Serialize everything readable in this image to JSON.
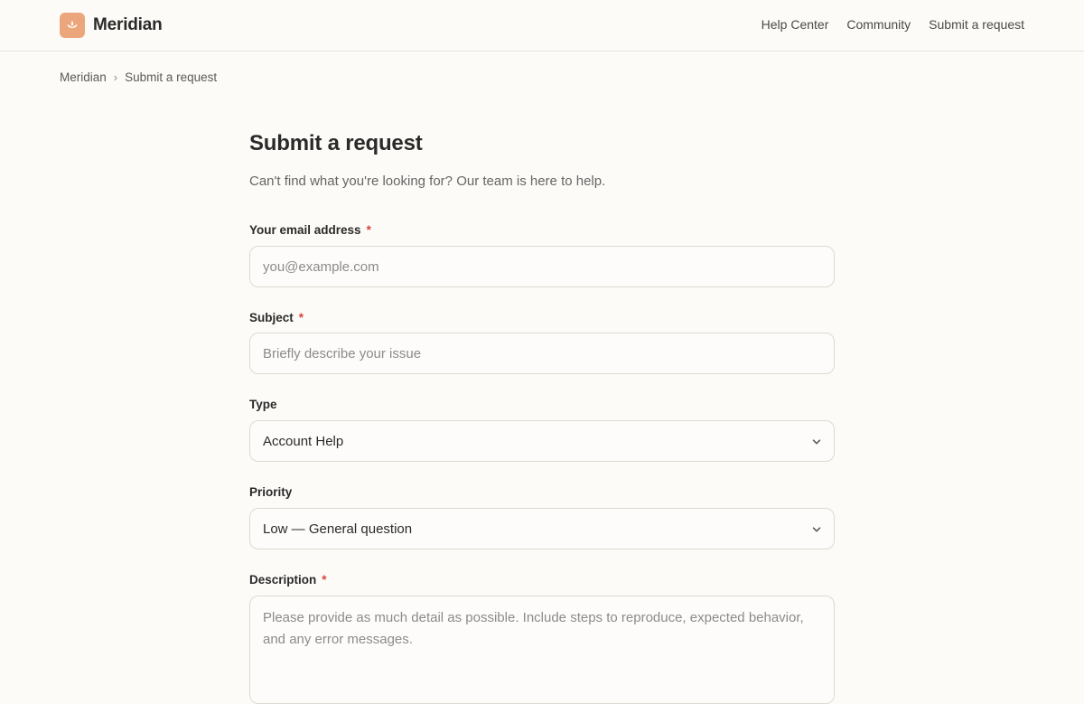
{
  "header": {
    "brand": "Meridian",
    "nav": [
      "Help Center",
      "Community",
      "Submit a request"
    ]
  },
  "breadcrumb": {
    "items": [
      "Meridian",
      "Submit a request"
    ],
    "separator": "›"
  },
  "form": {
    "title": "Submit a request",
    "subtitle": "Can't find what you're looking for? Our team is here to help.",
    "required_marker": "*",
    "email": {
      "label": "Your email address",
      "placeholder": "you@example.com",
      "value": ""
    },
    "subject": {
      "label": "Subject",
      "placeholder": "Briefly describe your issue",
      "value": ""
    },
    "type": {
      "label": "Type",
      "selected": "Account Help"
    },
    "priority": {
      "label": "Priority",
      "selected": "Low — General question"
    },
    "description": {
      "label": "Description",
      "placeholder": "Please provide as much detail as possible. Include steps to reproduce, expected behavior, and any error messages.",
      "value": ""
    }
  },
  "icons": {
    "logo": "lotus-icon",
    "select_arrow": "chevron-down-icon"
  },
  "colors": {
    "accent": "#eba67c",
    "required": "#d6443c",
    "background": "#fcfbf8",
    "border": "#dedad3"
  }
}
